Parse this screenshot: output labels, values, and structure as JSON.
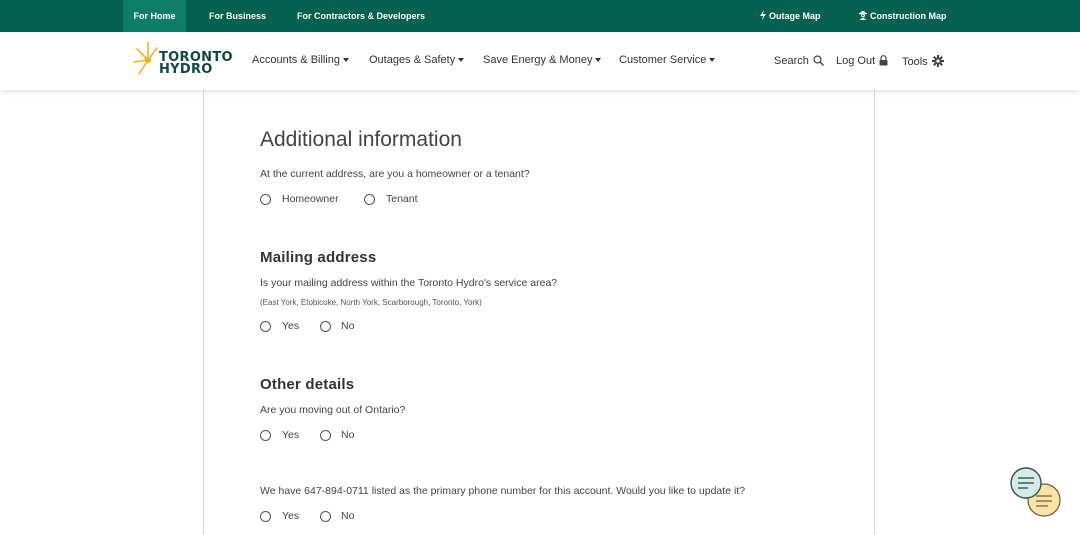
{
  "topbar": {
    "tabs": [
      {
        "label": "For Home"
      },
      {
        "label": "For Business"
      },
      {
        "label": "For Contractors & Developers"
      }
    ],
    "outage_map": "Outage Map",
    "construction_map": "Construction Map"
  },
  "header": {
    "logo": {
      "line1": "TORONTO",
      "line2": "HYDRO"
    },
    "nav": [
      {
        "label": "Accounts & Billing"
      },
      {
        "label": "Outages & Safety"
      },
      {
        "label": "Save Energy & Money"
      },
      {
        "label": "Customer Service"
      }
    ],
    "search": "Search",
    "logout": "Log Out",
    "tools": "Tools"
  },
  "colors": {
    "topbar": "#04614f",
    "topbar_active": "#0e7d68",
    "logo_sun": "#f2b31c",
    "logo_text": "#0b4c3e",
    "chat_teal": "#d4ebe7",
    "chat_yellow": "#fbe3a6"
  },
  "form": {
    "title": "Additional information",
    "ownership": {
      "question": "At the current address, are you a homeowner or a tenant?",
      "options": [
        "Homeowner",
        "Tenant"
      ]
    },
    "mailing": {
      "heading": "Mailing address",
      "question": "Is your mailing address within the Toronto Hydro's service area?",
      "hint": "(East York, Etobicoke, North York, Scarborough, Toronto, York)",
      "options": [
        "Yes",
        "No"
      ]
    },
    "other": {
      "heading": "Other details",
      "moving_question": "Are you moving out of Ontario?",
      "moving_options": [
        "Yes",
        "No"
      ],
      "phone_question": "We have 647-894-0711 listed as the primary phone number for this account. Would you like to update it?",
      "phone_options": [
        "Yes",
        "No"
      ]
    }
  },
  "icons": {
    "outage": "lightning-icon",
    "construction": "construction-worker-icon",
    "search": "search-icon",
    "logout": "lock-icon",
    "tools": "gear-icon",
    "chat": "chat-bubbles-icon"
  }
}
